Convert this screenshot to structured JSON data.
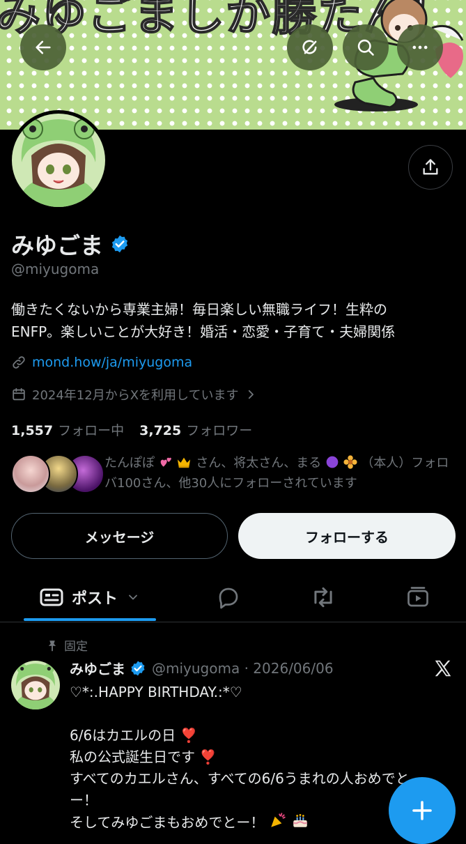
{
  "banner": {
    "title": "みゆごましか勝たん！",
    "colors": {
      "background": "#b9dc8e",
      "dots": "#ffffff"
    }
  },
  "header": {
    "back_icon": "arrow-left-icon",
    "grok_icon": "grok-icon",
    "search_icon": "search-icon",
    "more_icon": "more-icon"
  },
  "profile": {
    "display_name": "みゆごま",
    "verified_icon": "verified-badge-icon",
    "handle": "@miyugoma",
    "bio_line1": "働きたくないから専業主婦！毎日楽しい無職ライフ！生粋の",
    "bio_line2": "ENFP。楽しいことが大好き！婚活・恋愛・子育て・夫婦関係",
    "link": "mond.how/ja/miyugoma",
    "joined": "2024年12月からXを利用しています",
    "following_count": "1,557",
    "following_label": "フォロー中",
    "followers_count": "3,725",
    "followers_label": "フォロワー",
    "mutuals_a": "たんぽぽ",
    "mutuals_b": "さん、将太さん、まる",
    "mutuals_c": "（本人）フォロ",
    "mutuals_line2": "バ100さん、他30人にフォローされています"
  },
  "actions": {
    "message": "メッセージ",
    "follow": "フォローする"
  },
  "tabs": {
    "posts": "ポスト",
    "icons": [
      "posts-icon",
      "replies-icon",
      "reposts-icon",
      "media-icon"
    ]
  },
  "post": {
    "pinned_label": "固定",
    "author": "みゆごま",
    "handle_date": "@miyugoma · 2026/06/06",
    "line1": "♡*:.HAPPY BIRTHDAY.:*♡",
    "line3": "6/6はカエルの日 ❣️",
    "line4": "私の公式誕生日です ❣️",
    "line5": "すべてのカエルさん、すべての6/6うまれの人おめでと",
    "line6": "ー！",
    "line7": "そしてみゆごまもおめでとー！"
  },
  "colors": {
    "accent": "#1d9bf0",
    "muted": "#71767b",
    "text": "#e7e9ea",
    "background": "#000000"
  }
}
